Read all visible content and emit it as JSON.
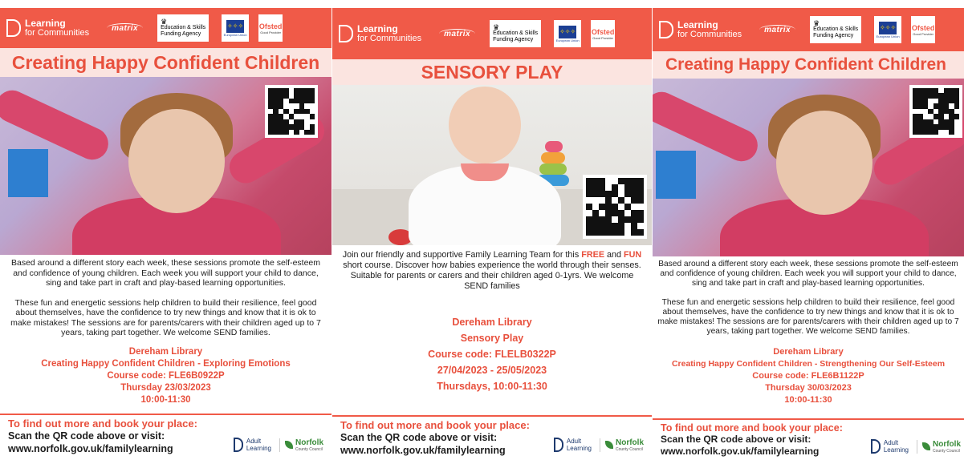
{
  "logos": {
    "lfc_line1": "Learning",
    "lfc_line2": "for Communities",
    "matrix": "matrix",
    "esfa_line1": "Education & Skills",
    "esfa_line2": "Funding Agency",
    "eu_caption": "European Union",
    "ofsted": "Ofsted",
    "ofsted_grade": "Good Provider",
    "adult_line1": "Adult",
    "adult_line2": "Learning",
    "norfolk": "Norfolk",
    "norfolk_sub": "County Council"
  },
  "footer": {
    "find_out": "To find out more and book your place:",
    "scan": "Scan the QR code above or visit:",
    "url": "www.norfolk.gov.uk/familylearning"
  },
  "posters": [
    {
      "title": "Creating Happy Confident Children",
      "para1": "Based around a different story each week, these sessions promote the self-esteem and confidence of young children. Each week you will support your child to dance, sing and take part in craft and play-based learning opportunities.",
      "para2": "These fun and energetic sessions help children to build their resilience, feel good about themselves, have the confidence to try new things and know that it is ok to make mistakes! The sessions are for parents/carers with their children aged up to 7 years, taking part together. We welcome SEND families.",
      "venue": "Dereham Library",
      "course_name": "Creating Happy Confident Children - Exploring Emotions",
      "code": "Course code: FLE6B0922P",
      "dates": "Thursday 23/03/2023",
      "time": "10:00-11:30"
    },
    {
      "title": "SENSORY PLAY",
      "intro_a": "Join our friendly and supportive Family Learning Team for this ",
      "free": "FREE",
      "intro_b": " and ",
      "fun": "FUN",
      "intro_c": " short course. Discover how babies experience the world through their senses. Suitable for parents or carers and their children aged 0-1yrs. We welcome SEND families",
      "venue": "Dereham Library",
      "course_name": "Sensory Play",
      "code": "Course code: FLELB0322P",
      "dates": "27/04/2023 - 25/05/2023",
      "time": "Thursdays, 10:00-11:30"
    },
    {
      "title": "Creating Happy Confident Children",
      "para1": "Based around a different story each week, these sessions promote the self-esteem and confidence of young children. Each week you will support your child to dance, sing and take part in craft and play-based learning opportunities.",
      "para2": "These fun and energetic sessions help children to build their resilience, feel good about themselves, have the confidence to try new things and know that it is ok to make mistakes! The sessions are for parents/carers with their children aged up to 7 years, taking part together. We welcome SEND families.",
      "venue": "Dereham Library",
      "course_name": "Creating Happy Confident Children - Strengthening Our Self-Esteem",
      "code": "Course code: FLE6B1122P",
      "dates": "Thursday 30/03/2023",
      "time": "10:00-11:30"
    }
  ],
  "colors": {
    "brand": "#f05a48",
    "title_bg": "#fbe4e0",
    "highlight": "#e8503d"
  }
}
